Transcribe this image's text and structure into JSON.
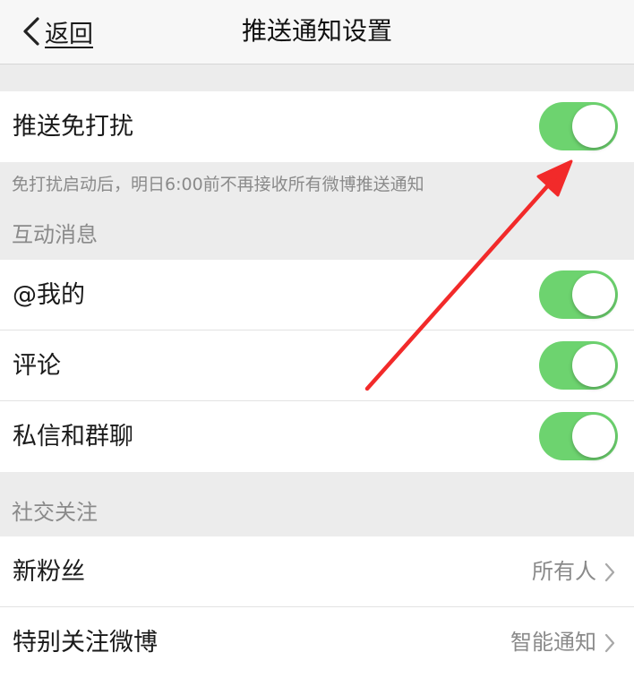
{
  "nav": {
    "back_label": "返回",
    "title": "推送通知设置"
  },
  "dnd": {
    "label": "推送免打扰",
    "enabled": true,
    "note": "免打扰启动后，明日6:00前不再接收所有微博推送通知"
  },
  "interaction": {
    "header": "互动消息",
    "items": [
      {
        "label": "@我的",
        "enabled": true
      },
      {
        "label": "评论",
        "enabled": true
      },
      {
        "label": "私信和群聊",
        "enabled": true
      }
    ]
  },
  "social": {
    "header": "社交关注",
    "items": [
      {
        "label": "新粉丝",
        "value": "所有人"
      },
      {
        "label": "特别关注微博",
        "value": "智能通知"
      }
    ]
  },
  "colors": {
    "toggle_on": "#6dd36f",
    "annotation_arrow": "#f22a2a"
  },
  "icons": [
    "chevron-left-icon",
    "chevron-right-icon",
    "annotation-arrow"
  ]
}
